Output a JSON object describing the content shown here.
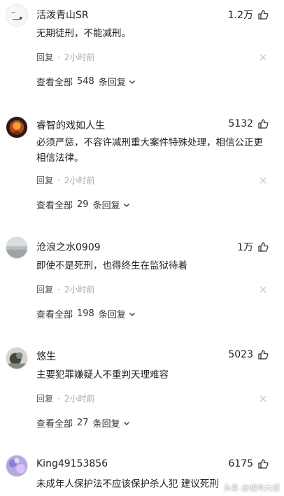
{
  "comments": [
    {
      "username": "活泼青山SR",
      "likes": "1.2万",
      "content": "无期徒刑，不能减刑。",
      "reply_label": "回复",
      "time": "2小时前",
      "view_prefix": "查看全部",
      "reply_count": "548",
      "view_suffix": "条回复"
    },
    {
      "username": "睿智的戏如人生",
      "likes": "5132",
      "content": "必须严惩，不容许减刑重大案件特殊处理，相信公正更相信法律。",
      "reply_label": "回复",
      "time": "2小时前",
      "view_prefix": "查看全部",
      "reply_count": "29",
      "view_suffix": "条回复"
    },
    {
      "username": "沧浪之水0909",
      "likes": "1万",
      "content": "即使不是死刑，也得终生在监狱待着",
      "reply_label": "回复",
      "time": "2小时前",
      "view_prefix": "查看全部",
      "reply_count": "198",
      "view_suffix": "条回复"
    },
    {
      "username": "悠生",
      "likes": "5023",
      "content": "主要犯罪嫌疑人不重判天理难容",
      "reply_label": "回复",
      "time": "2小时前",
      "view_prefix": "查看全部",
      "reply_count": "27",
      "view_suffix": "条回复"
    },
    {
      "username": "King49153856",
      "likes": "6175",
      "content": "未成年人保护法不应该保护杀人犯 建议死刑"
    }
  ],
  "watermark": "头条 @戎州大叔",
  "icons": {
    "like": "thumbs-up-icon",
    "close": "close-icon",
    "expand": "chevron-down-icon"
  }
}
